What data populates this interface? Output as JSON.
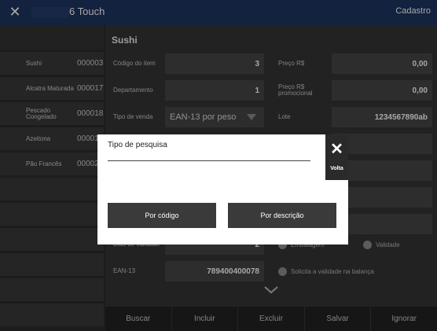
{
  "header": {
    "close_icon": "close-icon",
    "app_name": "6 Touch",
    "screen": "Cadastro"
  },
  "sidebar": {
    "items": [
      {
        "name": "Sushi",
        "code": "000003"
      },
      {
        "name": "Alcatra Maturada",
        "code": "000017"
      },
      {
        "name": "Pescado Congelado",
        "code": "000018"
      },
      {
        "name": "Azeitona",
        "code": "00001"
      },
      {
        "name": "Pão Francês",
        "code": "00002"
      }
    ]
  },
  "form": {
    "title": "Sushi",
    "codigo_item": {
      "label": "Código do item",
      "value": "3"
    },
    "preco": {
      "label": "Preço R$",
      "value": "0,00"
    },
    "departamento": {
      "label": "Departamento",
      "value": "1"
    },
    "preco_promocional": {
      "label": "Preço R$ promocional",
      "value": "0,00"
    },
    "tipo_venda": {
      "label": "Tipo de venda",
      "value": "EAN-13 por peso"
    },
    "lote": {
      "label": "Lote",
      "value": "1234567890ab"
    },
    "dias_validade": {
      "label": "Dias de validade",
      "value": "2"
    },
    "radio_embalagem": "Embalagem",
    "radio_validade": "Validade",
    "ean13": {
      "label": "EAN-13",
      "value": "789400400078"
    },
    "solicita_validade": "Solicita a validade na balança",
    "expand_icon": "chevron-down-icon"
  },
  "toolbar": {
    "buscar": "Buscar",
    "incluir": "Incluir",
    "excluir": "Excluir",
    "salvar": "Salvar",
    "ignorar": "Ignorar"
  },
  "dialog": {
    "label": "Tipo de pesquisa",
    "input_value": "",
    "close_label": "Volta",
    "btn_codigo": "Por código",
    "btn_descricao": "Por descrição"
  }
}
